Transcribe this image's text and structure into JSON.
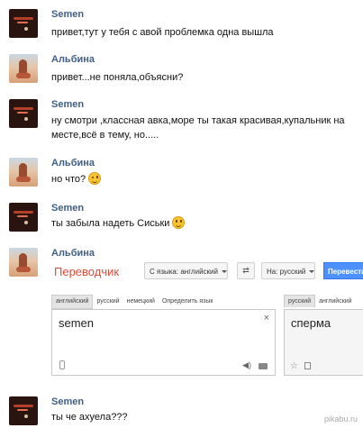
{
  "messages": [
    {
      "author": "Semen",
      "lines": [
        "привет,тут у тебя с авой проблемка одна вышла"
      ]
    },
    {
      "author": "Альбина",
      "lines": [
        "привет...не поняла,объясни?"
      ]
    },
    {
      "author": "Semen",
      "lines": [
        "ну смотри ,классная авка,море ты такая красивая,купальник на",
        "месте,всё в тему, но....."
      ]
    },
    {
      "author": "Альбина",
      "lines": [
        "но что?"
      ],
      "emoji": "wink-emoji"
    },
    {
      "author": "Semen",
      "lines": [
        "ты забыла надеть Сиськи"
      ],
      "emoji": "smile-emoji"
    },
    {
      "author": "Альбина",
      "lines": []
    },
    {
      "author": "Semen",
      "lines": [
        "ты че ахуела???"
      ]
    }
  ],
  "translator": {
    "title": "Переводчик",
    "from_label": "С языка: английский",
    "to_label": "На: русский",
    "translate_label": "Перевести",
    "source_tabs": [
      "английский",
      "русский",
      "немецкий",
      "Определить язык"
    ],
    "target_tabs": [
      "русский",
      "английский"
    ],
    "source_text": "semen",
    "target_text": "сперма",
    "clear_symbol": "×",
    "accent_color": "#dd4b39",
    "button_color": "#4d90fe"
  },
  "watermark": "pikabu.ru"
}
